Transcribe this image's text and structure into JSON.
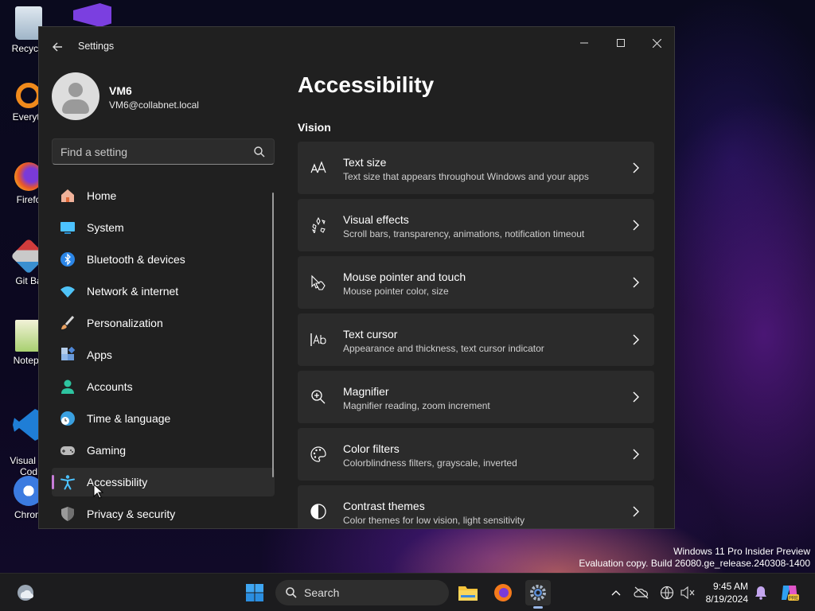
{
  "desktop": {
    "icons": [
      {
        "label": "Recycle",
        "icon": "recycle-bin-icon"
      },
      {
        "label": "Everyth",
        "icon": "everything-search-icon"
      },
      {
        "label": "Firefo",
        "icon": "firefox-icon"
      },
      {
        "label": "Git Ba",
        "icon": "git-bash-icon"
      },
      {
        "label": "Notepa",
        "icon": "notepad-plus-plus-icon"
      },
      {
        "label": "Visual St\nCod",
        "icon": "vscode-icon"
      },
      {
        "label": "Chrom",
        "icon": "chrome-icon"
      }
    ],
    "watermark_line1": "Windows 11 Pro Insider Preview",
    "watermark_line2": "Evaluation copy. Build 26080.ge_release.240308-1400"
  },
  "window": {
    "title": "Settings"
  },
  "user": {
    "name": "VM6",
    "email": "VM6@collabnet.local"
  },
  "search": {
    "placeholder": "Find a setting"
  },
  "nav": [
    {
      "label": "Home",
      "icon": "home-icon",
      "color": "#e8835a"
    },
    {
      "label": "System",
      "icon": "system-icon",
      "color": "#4cc2ff"
    },
    {
      "label": "Bluetooth & devices",
      "icon": "bluetooth-icon",
      "color": "#2b86e8"
    },
    {
      "label": "Network & internet",
      "icon": "network-icon",
      "color": "#4fc3f7"
    },
    {
      "label": "Personalization",
      "icon": "brush-icon",
      "color": "#e8a060"
    },
    {
      "label": "Apps",
      "icon": "apps-icon",
      "color": "#8fb7e8"
    },
    {
      "label": "Accounts",
      "icon": "accounts-icon",
      "color": "#2ec4a0"
    },
    {
      "label": "Time & language",
      "icon": "globe-clock-icon",
      "color": "#3aa0e0"
    },
    {
      "label": "Gaming",
      "icon": "gaming-icon",
      "color": "#b9b9b9"
    },
    {
      "label": "Accessibility",
      "icon": "accessibility-icon",
      "color": "#4cc2ff",
      "active": true
    },
    {
      "label": "Privacy & security",
      "icon": "shield-icon",
      "color": "#9a9a9a"
    }
  ],
  "main": {
    "title": "Accessibility",
    "section": "Vision",
    "cards": [
      {
        "title": "Text size",
        "desc": "Text size that appears throughout Windows and your apps",
        "icon": "text-size-icon"
      },
      {
        "title": "Visual effects",
        "desc": "Scroll bars, transparency, animations, notification timeout",
        "icon": "visual-effects-icon"
      },
      {
        "title": "Mouse pointer and touch",
        "desc": "Mouse pointer color, size",
        "icon": "mouse-pointer-icon"
      },
      {
        "title": "Text cursor",
        "desc": "Appearance and thickness, text cursor indicator",
        "icon": "text-cursor-icon"
      },
      {
        "title": "Magnifier",
        "desc": "Magnifier reading, zoom increment",
        "icon": "magnifier-icon"
      },
      {
        "title": "Color filters",
        "desc": "Colorblindness filters, grayscale, inverted",
        "icon": "color-filters-icon"
      },
      {
        "title": "Contrast themes",
        "desc": "Color themes for low vision, light sensitivity",
        "icon": "contrast-icon"
      }
    ]
  },
  "taskbar": {
    "search_label": "Search",
    "time": "9:45 AM",
    "date": "8/19/2024"
  },
  "colors": {
    "accent": "#c77dd8",
    "window_bg": "#202020",
    "card_bg": "#2b2b2b"
  }
}
